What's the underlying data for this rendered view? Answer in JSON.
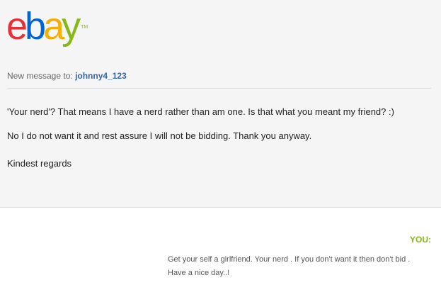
{
  "brand": {
    "letters": [
      {
        "char": "e",
        "color": "#e53238"
      },
      {
        "char": "b",
        "color": "#0064d2"
      },
      {
        "char": "a",
        "color": "#f5af02"
      },
      {
        "char": "y",
        "color": "#86b817"
      }
    ],
    "trademark": "TM"
  },
  "header": {
    "to_prefix": "New message to:",
    "recipient": "johnny4_123"
  },
  "message": {
    "lines": [
      "'Your nerd'? That means I have a nerd rather than am one. Is that what you meant my friend? :)",
      "No I do not want it and rest assure I will not be bidding. Thank you anyway.",
      "Kindest regards"
    ]
  },
  "quoted": {
    "label": "YOU:",
    "lines": [
      "Get your self a girlfriend. Your nerd . If you don't want it then don't bid .",
      "Have a nice day..!"
    ]
  }
}
